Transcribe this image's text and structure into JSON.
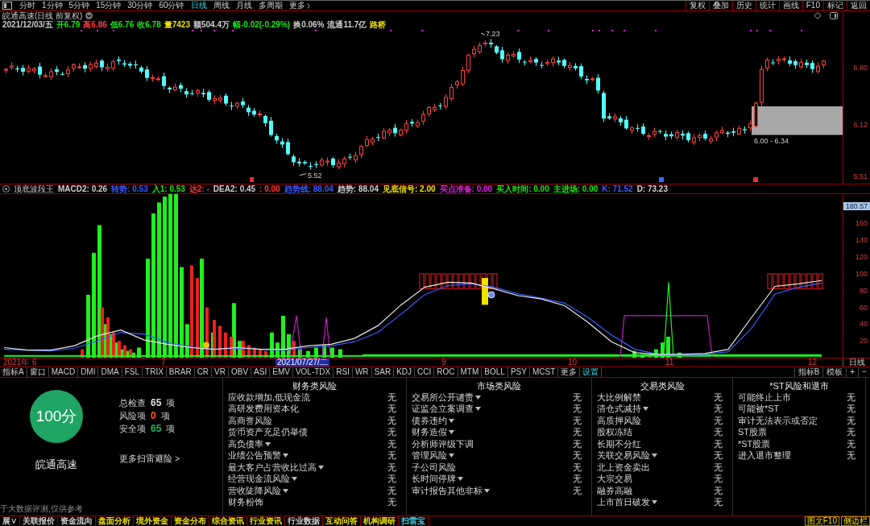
{
  "toolbar": {
    "periods": [
      {
        "label": "分时",
        "selected": false
      },
      {
        "label": "1分钟",
        "selected": false
      },
      {
        "label": "5分钟",
        "selected": false
      },
      {
        "label": "15分钟",
        "selected": false
      },
      {
        "label": "30分钟",
        "selected": false
      },
      {
        "label": "60分钟",
        "selected": false
      },
      {
        "label": "日线",
        "selected": true
      },
      {
        "label": "周线",
        "selected": false
      },
      {
        "label": "月线",
        "selected": false
      },
      {
        "label": "多周期",
        "selected": false
      }
    ],
    "more_menu": "更多",
    "tools": [
      "复权",
      "叠加",
      "历史",
      "统计",
      "画线",
      "F10",
      "标记",
      "返回"
    ]
  },
  "chart_header": {
    "title": "皖通高速(日线 前复权)"
  },
  "quote": [
    {
      "text": "2021/12/03/五",
      "color": "#d0d0d0"
    },
    {
      "text": "开6.79",
      "color": "#19e619"
    },
    {
      "text": "高6.86",
      "color": "#ff3b3b"
    },
    {
      "text": "低6.76",
      "color": "#19e619"
    },
    {
      "text": "收6.78",
      "color": "#19e619"
    },
    {
      "text": "量7423",
      "color": "#f0e000"
    },
    {
      "text": "额504.4万",
      "color": "#d0d0d0"
    },
    {
      "text": "幅-0.02(-0.29%)",
      "color": "#19e619"
    },
    {
      "text": "换0.06%",
      "color": "#d0d0d0"
    },
    {
      "text": "流通11.7亿",
      "color": "#d0d0d0"
    },
    {
      "text": "路桥",
      "color": "#f0e000"
    }
  ],
  "main_chart": {
    "high_label": "7.23",
    "low_label": "5.52",
    "range_label": "6.00 - 6.34",
    "axis": [
      "6.80",
      "6.12",
      "5.51"
    ]
  },
  "indicator": {
    "name": "顶底波段王",
    "values": [
      {
        "text": "MACD2: 0.26",
        "color": "#d0d0d0"
      },
      {
        "text": "转势: 0.53",
        "color": "#3a5cff"
      },
      {
        "text": "入1: 0.53",
        "color": "#19e619"
      },
      {
        "text": "达2: -",
        "color": "#ff3b3b"
      },
      {
        "text": "DEA2: 0.45",
        "color": "#d0d0d0"
      },
      {
        "text": ": 0.00",
        "color": "#ff3b3b"
      },
      {
        "text": "趋势线: 88.04",
        "color": "#3a5cff"
      },
      {
        "text": "趋势: 88.04",
        "color": "#d0d0d0"
      },
      {
        "text": "见底信号: 2.00",
        "color": "#f0e000"
      },
      {
        "text": "买点准备: 0.00",
        "color": "#e020e0"
      },
      {
        "text": "买入时间: 0.00",
        "color": "#19e619"
      },
      {
        "text": "主进场: 0.00",
        "color": "#19e619"
      },
      {
        "text": "K: 71.52",
        "color": "#3a5cff"
      },
      {
        "text": "D: 73.23",
        "color": "#d0d0d0"
      }
    ],
    "cursor_value": "180.57",
    "chart_data": {
      "type": "line",
      "ylim": [
        0,
        195
      ],
      "yticks": [
        20,
        40,
        60,
        80,
        100,
        120,
        140,
        160
      ],
      "series": [
        {
          "color": "#e8e8e8",
          "values": [
            12,
            9,
            9,
            14,
            26,
            33,
            21,
            16,
            12,
            10,
            12,
            10,
            10,
            14,
            16,
            23,
            38,
            63,
            84,
            90,
            89,
            82,
            74,
            70,
            62,
            42,
            19,
            6,
            4,
            4,
            5,
            10,
            48,
            85,
            88,
            92
          ]
        },
        {
          "color": "#3a5cff",
          "values": [
            10,
            9,
            8,
            11,
            20,
            30,
            28,
            18,
            13,
            10,
            11,
            10,
            9,
            12,
            14,
            19,
            30,
            52,
            75,
            86,
            88,
            84,
            76,
            71,
            65,
            48,
            27,
            10,
            4,
            3,
            4,
            7,
            35,
            76,
            84,
            89
          ]
        }
      ]
    }
  },
  "time_axis": {
    "labels": [
      "2021年",
      "6",
      "7",
      "9",
      "10",
      "11",
      "12"
    ],
    "cursor_date": "2021/07/27/二",
    "period": "日线"
  },
  "indicator_tabs": [
    {
      "label": "指标A",
      "selected": false
    },
    {
      "label": "窗口",
      "selected": false
    },
    {
      "label": "MACD",
      "selected": false
    },
    {
      "label": "DMI",
      "selected": false
    },
    {
      "label": "DMA",
      "selected": false
    },
    {
      "label": "FSL",
      "selected": false
    },
    {
      "label": "TRIX",
      "selected": false
    },
    {
      "label": "BRAR",
      "selected": false
    },
    {
      "label": "CR",
      "selected": false
    },
    {
      "label": "VR",
      "selected": false
    },
    {
      "label": "OBV",
      "selected": false
    },
    {
      "label": "ASI",
      "selected": false
    },
    {
      "label": "EMV",
      "selected": false
    },
    {
      "label": "VOL-TDX",
      "selected": false
    },
    {
      "label": "RSI",
      "selected": false
    },
    {
      "label": "WR",
      "selected": false
    },
    {
      "label": "SAR",
      "selected": false
    },
    {
      "label": "KDJ",
      "selected": false
    },
    {
      "label": "CCI",
      "selected": false
    },
    {
      "label": "ROC",
      "selected": false
    },
    {
      "label": "MTM",
      "selected": false
    },
    {
      "label": "BOLL",
      "selected": false
    },
    {
      "label": "PSY",
      "selected": false
    },
    {
      "label": "MCST",
      "selected": false
    },
    {
      "label": "更多",
      "selected": false
    },
    {
      "label": "设置",
      "selected": true
    }
  ],
  "indicator_tools": [
    "指标B",
    "模板",
    "+",
    "−"
  ],
  "risk_scan": {
    "score": "100分",
    "stock": "皖通高速",
    "summary": [
      {
        "label": "总检查",
        "count": "65",
        "unit": "项",
        "color": "#e0e0e0"
      },
      {
        "label": "风险项",
        "count": "0",
        "unit": "项",
        "color": "#ff5a1a"
      },
      {
        "label": "安全项",
        "count": "65",
        "unit": "项",
        "color": "#1fb45a"
      }
    ],
    "more_link": "更多扫雷避险 >",
    "disclaimer": "于大数据评测,仅供参考",
    "categories": [
      {
        "title": "财务类风险",
        "items": [
          {
            "name": "应收款增加,低现金流",
            "expandable": false,
            "result": "无"
          },
          {
            "name": "高研发费用资本化",
            "expandable": false,
            "result": "无"
          },
          {
            "name": "高商誉风险",
            "expandable": false,
            "result": "无"
          },
          {
            "name": "货币资产充足仍举债",
            "expandable": false,
            "result": "无"
          },
          {
            "name": "高负债率",
            "expandable": true,
            "result": "无"
          },
          {
            "name": "业绩公告预警",
            "expandable": true,
            "result": "无"
          },
          {
            "name": "最大客户占营收比过高",
            "expandable": true,
            "result": "无"
          },
          {
            "name": "经营现金流风险",
            "expandable": true,
            "result": "无"
          },
          {
            "name": "营收陡降风险",
            "expandable": true,
            "result": "无"
          },
          {
            "name": "财务粉饰",
            "expandable": false,
            "result": "无"
          }
        ]
      },
      {
        "title": "市场类风险",
        "items": [
          {
            "name": "交易所公开谴责",
            "expandable": true,
            "result": "无"
          },
          {
            "name": "证监会立案调查",
            "expandable": true,
            "result": "无"
          },
          {
            "name": "债券违约",
            "expandable": true,
            "result": "无"
          },
          {
            "name": "财务造假",
            "expandable": true,
            "result": "无"
          },
          {
            "name": "分析师评级下调",
            "expandable": false,
            "result": "无"
          },
          {
            "name": "管理风险",
            "expandable": true,
            "result": "无"
          },
          {
            "name": "子公司风险",
            "expandable": false,
            "result": "无"
          },
          {
            "name": "长时间停牌",
            "expandable": true,
            "result": "无"
          },
          {
            "name": "审计报告其他非标",
            "expandable": true,
            "result": "无"
          }
        ]
      },
      {
        "title": "交易类风险",
        "items": [
          {
            "name": "大比例解禁",
            "expandable": false,
            "result": "无"
          },
          {
            "name": "清仓式减持",
            "expandable": true,
            "result": "无"
          },
          {
            "name": "高质押风险",
            "expandable": false,
            "result": "无"
          },
          {
            "name": "股权冻结",
            "expandable": false,
            "result": "无"
          },
          {
            "name": "长期不分红",
            "expandable": false,
            "result": "无"
          },
          {
            "name": "关联交易风险",
            "expandable": true,
            "result": "无"
          },
          {
            "name": "北上资金卖出",
            "expandable": false,
            "result": "无"
          },
          {
            "name": "大宗交易",
            "expandable": false,
            "result": "无"
          },
          {
            "name": "融券高融",
            "expandable": false,
            "result": "无"
          },
          {
            "name": "上市首日破发",
            "expandable": true,
            "result": "无"
          }
        ]
      },
      {
        "title": "*ST风险和退市",
        "items": [
          {
            "name": "可能终止上市",
            "expandable": false,
            "result": "无"
          },
          {
            "name": "可能被*ST",
            "expandable": false,
            "result": "无"
          },
          {
            "name": "审计无法表示或否定",
            "expandable": false,
            "result": "无"
          },
          {
            "name": "ST股票",
            "expandable": false,
            "result": "无"
          },
          {
            "name": "*ST股票",
            "expandable": false,
            "result": "无"
          },
          {
            "name": "进入退市整理",
            "expandable": false,
            "result": "无"
          }
        ]
      }
    ]
  },
  "bottom_tabs": [
    {
      "label": "展∨",
      "color": "#d0d0d0"
    },
    {
      "label": "关联报价",
      "color": "#d0d0d0"
    },
    {
      "label": "资金流向",
      "color": "#d0d0d0"
    },
    {
      "label": "盘面分析",
      "color": "#f0e000"
    },
    {
      "label": "境外资金",
      "color": "#f0e000"
    },
    {
      "label": "资金分布",
      "color": "#f0e000"
    },
    {
      "label": "综合资讯",
      "color": "#f0e000"
    },
    {
      "label": "行业资讯",
      "color": "#f0e000"
    },
    {
      "label": "行业数据",
      "color": "#d0d0d0"
    },
    {
      "label": "互动问答",
      "color": "#f0e000"
    },
    {
      "label": "机构调研",
      "color": "#f0e000"
    },
    {
      "label": "扫雷宝",
      "color": "#3ad8e8"
    }
  ],
  "side_buttons": [
    "图文F10",
    "侧边栏"
  ]
}
